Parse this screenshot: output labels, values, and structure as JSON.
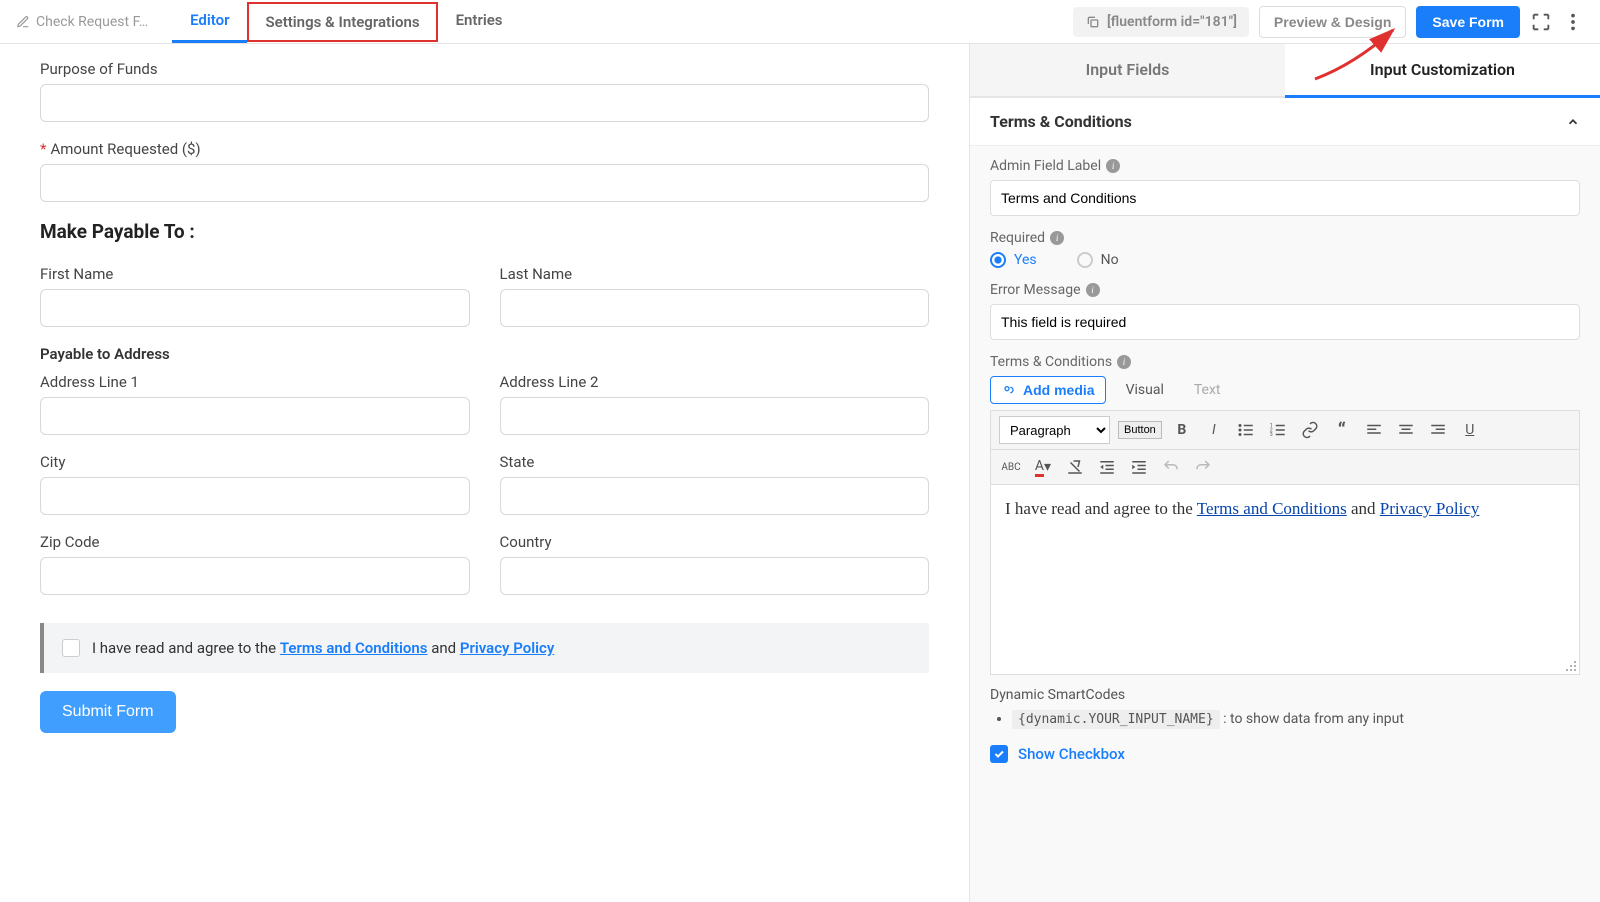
{
  "topbar": {
    "form_name": "Check Request F…",
    "nav": {
      "editor": "Editor",
      "settings": "Settings & Integrations",
      "entries": "Entries"
    },
    "shortcode": "[fluentform id=\"181\"]",
    "preview": "Preview & Design",
    "save": "Save Form"
  },
  "form": {
    "purpose_label": "Purpose of Funds",
    "amount_label": "Amount Requested ($)",
    "payable_title": "Make Payable To :",
    "first_name": "First Name",
    "last_name": "Last Name",
    "address_title": "Payable to Address",
    "addr1": "Address Line 1",
    "addr2": "Address Line 2",
    "city": "City",
    "state": "State",
    "zip": "Zip Code",
    "country": "Country",
    "terms_pre": "I have read and agree to the ",
    "terms_link1": "Terms and Conditions",
    "terms_mid": " and ",
    "terms_link2": "Privacy Policy",
    "submit": "Submit Form"
  },
  "sidebar": {
    "tab_fields": "Input Fields",
    "tab_custom": "Input Customization",
    "section_title": "Terms & Conditions",
    "admin_label_lbl": "Admin Field Label",
    "admin_label_val": "Terms and Conditions",
    "required_lbl": "Required",
    "yes": "Yes",
    "no": "No",
    "error_lbl": "Error Message",
    "error_val": "This field is required",
    "tc_lbl": "Terms & Conditions",
    "add_media": "Add media",
    "visual": "Visual",
    "text_tab": "Text",
    "para": "Paragraph",
    "button_btn": "Button",
    "editor_pre": "I have read and agree to the ",
    "editor_l1": "Terms and Conditions",
    "editor_mid": " and ",
    "editor_l2": "Privacy Policy",
    "sc_title": "Dynamic SmartCodes",
    "sc_code": "{dynamic.YOUR_INPUT_NAME}",
    "sc_desc": " : to show data from any input",
    "show_checkbox": "Show Checkbox"
  }
}
